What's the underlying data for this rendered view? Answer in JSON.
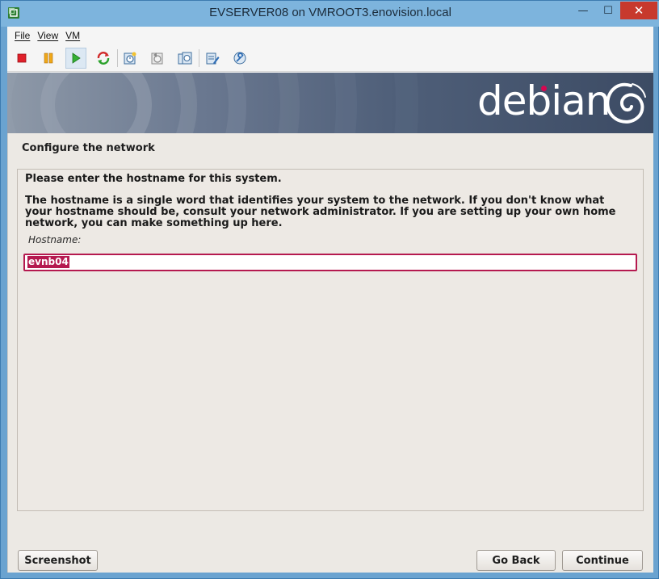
{
  "window": {
    "title": "EVSERVER08 on VMROOT3.enovision.local",
    "minimize_glyph": "—",
    "maximize_glyph": "☐",
    "close_glyph": "✕"
  },
  "menu": {
    "items": [
      {
        "label": "File"
      },
      {
        "label": "View"
      },
      {
        "label": "VM"
      }
    ]
  },
  "toolbar": {
    "buttons": [
      {
        "name": "power-off",
        "icon": "stop-icon",
        "color": "#e0202a"
      },
      {
        "name": "suspend",
        "icon": "pause-icon",
        "color": "#e89b12"
      },
      {
        "name": "power-on",
        "icon": "play-icon",
        "color": "#2aa12a"
      },
      {
        "name": "reset",
        "icon": "reset-icon",
        "color": "#d12b2b"
      },
      {
        "name": "take-snapshot",
        "icon": "snapshot-icon"
      },
      {
        "name": "revert-snapshot",
        "icon": "snapshot-revert-icon"
      },
      {
        "name": "manage-snapshots",
        "icon": "snapshot-manager-icon"
      },
      {
        "name": "edit-settings",
        "icon": "edit-settings-icon"
      },
      {
        "name": "vm-tools",
        "icon": "wrench-icon"
      }
    ]
  },
  "installer": {
    "brand": "debian",
    "brand_accent": "#d70751",
    "step_title": "Configure the network",
    "question": "Please enter the hostname for this system.",
    "description": "The hostname is a single word that identifies your system to the network. If you don't know what your hostname should be, consult your network administrator. If you are setting up your own home network, you can make something up here.",
    "field_label": "Hostname:",
    "hostname_value": "evnb04",
    "buttons": {
      "screenshot": "Screenshot",
      "go_back": "Go Back",
      "continue": "Continue"
    }
  }
}
